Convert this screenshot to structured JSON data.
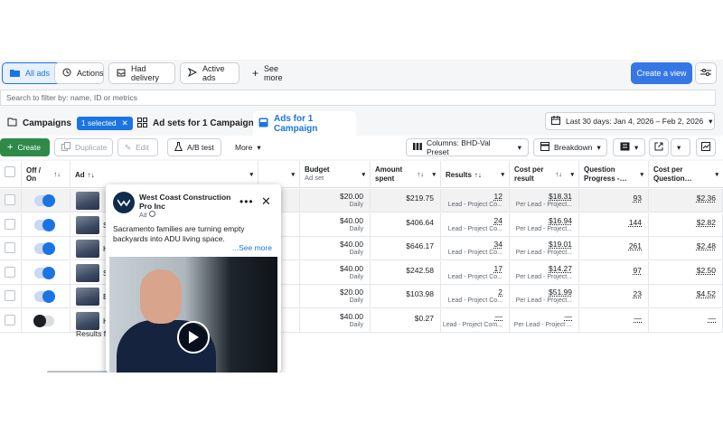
{
  "topbar": {
    "all_ads": "All ads",
    "actions": "Actions",
    "had_delivery": "Had delivery",
    "active_ads": "Active ads",
    "see_more": "See more",
    "create_view": "Create a view"
  },
  "search": {
    "placeholder": "Search to filter by: name, ID or metrics"
  },
  "tabs": {
    "campaigns": "Campaigns",
    "selected": "1 selected",
    "ad_sets": "Ad sets for 1 Campaign",
    "ads": "Ads for 1 Campaign",
    "date_range": "Last 30 days: Jan 4, 2026 – Feb 2, 2026"
  },
  "toolbar": {
    "create": "Create",
    "duplicate": "Duplicate",
    "edit": "Edit",
    "ab_test": "A/B test",
    "more": "More",
    "columns": "Columns: BHD-Val Preset",
    "breakdown": "Breakdown"
  },
  "table": {
    "headers": {
      "off_on": "Off / On",
      "ad": "Ad",
      "budget": "Budget",
      "budget_sub": "Ad set",
      "amount_spent": "Amount spent",
      "results": "Results",
      "cost_per_result": "Cost per result",
      "question_progress": "Question Progress -…",
      "cost_per_question": "Cost per Question…"
    },
    "rows": [
      {
        "on": true,
        "ad_letter": "",
        "budget": "$20.00",
        "budget_sub": "Daily",
        "spent": "$219.75",
        "results": "12",
        "results_sub": "Lead - Project Co...",
        "cpr": "$18.31",
        "cpr_sub": "Per Lead - Project...",
        "qp": "93",
        "cpq": "$2.36"
      },
      {
        "on": true,
        "ad_letter": "S",
        "budget": "$40.00",
        "budget_sub": "Daily",
        "spent": "$406.64",
        "results": "24",
        "results_sub": "Lead - Project Co...",
        "cpr": "$16.94",
        "cpr_sub": "Per Lead - Project...",
        "qp": "144",
        "cpq": "$2.82"
      },
      {
        "on": true,
        "ad_letter": "H",
        "budget": "$40.00",
        "budget_sub": "Daily",
        "spent": "$646.17",
        "results": "34",
        "results_sub": "Lead - Project Co...",
        "cpr": "$19.01",
        "cpr_sub": "Per Lead - Project...",
        "qp": "261",
        "cpq": "$2.48"
      },
      {
        "on": true,
        "ad_letter": "S",
        "budget": "$40.00",
        "budget_sub": "Daily",
        "spent": "$242.58",
        "results": "17",
        "results_sub": "Lead - Project Co...",
        "cpr": "$14.27",
        "cpr_sub": "Per Lead - Project...",
        "qp": "97",
        "cpq": "$2.50"
      },
      {
        "on": true,
        "ad_letter": "E",
        "budget": "$20.00",
        "budget_sub": "Daily",
        "spent": "$103.98",
        "results": "2",
        "results_sub": "Lead - Project Co...",
        "cpr": "$51.99",
        "cpr_sub": "Per Lead - Project...",
        "qp": "23",
        "cpq": "$4.52"
      },
      {
        "on": false,
        "ad_letter": "H",
        "budget": "$40.00",
        "budget_sub": "Daily",
        "spent": "$0.27",
        "results": "—",
        "results_sub": "Lead - Project Com...",
        "cpr": "—",
        "cpr_sub": "Per Lead - Project ...",
        "qp": "—",
        "cpq": "—"
      }
    ],
    "results_footer": "Results f"
  },
  "preview": {
    "page_name": "West Coast Construction Pro Inc",
    "ad_label": "Ad",
    "text": "Sacramento families are turning empty backyards into ADU living space.",
    "see_more": "...See more"
  },
  "colors": {
    "accent": "#1b74e4",
    "create_green": "#2f8a4a"
  }
}
